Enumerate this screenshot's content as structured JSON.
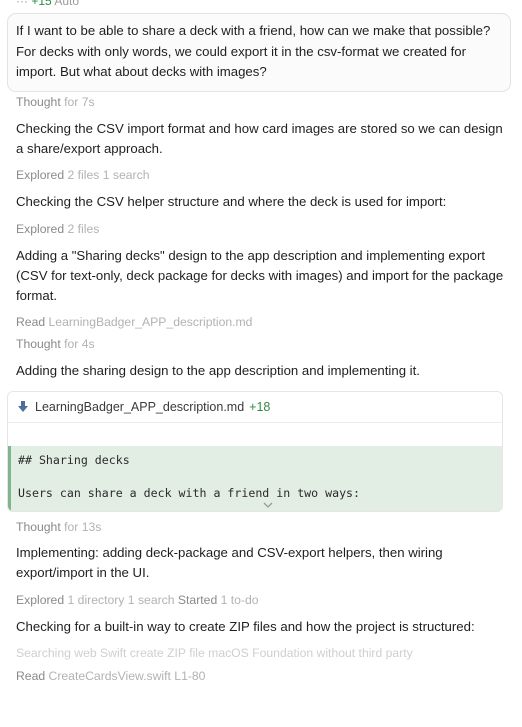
{
  "header": {
    "partial_left": "···",
    "partial_green": "+15",
    "partial_right": "Auto"
  },
  "user_message": {
    "text": "If I want to be able to share a deck with a friend, how can we make that possible? For decks with only words, we could export it in the csv-format we created for import. But what about decks with images?"
  },
  "steps": {
    "thought1": {
      "label": "Thought",
      "detail": "for 7s"
    },
    "para1": "Checking the CSV import format and how card images are stored so we can design a share/export approach.",
    "explored1": {
      "label": "Explored",
      "detail": "2 files 1 search"
    },
    "para2": "Checking the CSV helper structure and where the deck is used for import:",
    "explored2": {
      "label": "Explored",
      "detail": "2 files"
    },
    "para3": "Adding a \"Sharing decks\" design to the app description and implementing export (CSV for text-only, deck package for decks with images) and import for the package format.",
    "read1": {
      "label": "Read",
      "detail": "LearningBadger_APP_description.md"
    },
    "thought2": {
      "label": "Thought",
      "detail": "for 4s"
    },
    "para4": "Adding the sharing design to the app description and implementing it.",
    "thought3": {
      "label": "Thought",
      "detail": "for 13s"
    },
    "para5": "Implementing: adding deck-package and CSV-export helpers, then wiring export/import in the UI.",
    "explored3": {
      "label": "Explored",
      "detail": "1 directory 1 search",
      "label2": "Started",
      "detail2": "1 to-do"
    },
    "para6": "Checking for a built-in way to create ZIP files and how the project is structured:",
    "searching": {
      "label": "Searching web",
      "detail": "Swift create ZIP file macOS Foundation without third party"
    },
    "read2": {
      "label": "Read",
      "detail": "CreateCardsView.swift L1-80"
    }
  },
  "diff": {
    "file_icon": "download-arrow-icon",
    "filename": "LearningBadger_APP_description.md",
    "added": "+18",
    "line1": "## Sharing decks",
    "line2": "Users can share a deck with a friend in two ways:"
  },
  "colors": {
    "accent_green": "#2f8a45",
    "diff_bg": "#e2ede4",
    "diff_border": "#7fb48d",
    "icon_blue": "#4a6f9c"
  }
}
